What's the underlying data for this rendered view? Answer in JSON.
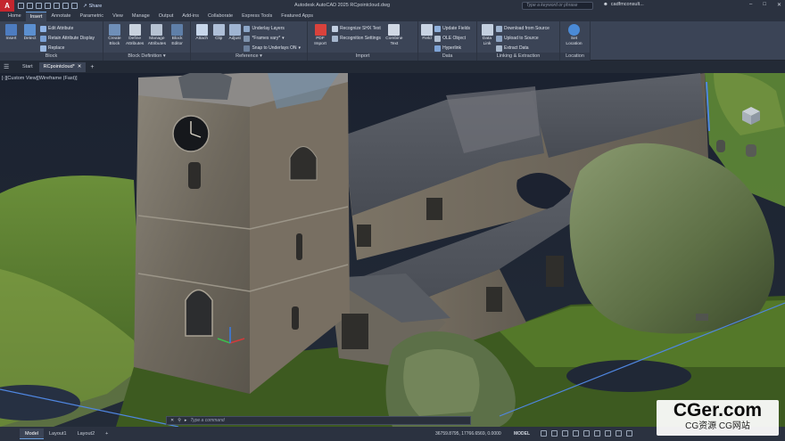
{
  "titlebar": {
    "app_letter": "A",
    "share_label": "Share",
    "title": "Autodesk AutoCAD 2025   RCpointcloud.dwg",
    "search_placeholder": "Type a keyword or phrase",
    "user": "cadfmconsult..."
  },
  "ribbon_tabs": [
    "Home",
    "Insert",
    "Annotate",
    "Parametric",
    "View",
    "Manage",
    "Output",
    "Add-ins",
    "Collaborate",
    "Express Tools",
    "Featured Apps"
  ],
  "active_ribbon_tab": "Insert",
  "panels": {
    "block": {
      "title": "Block",
      "insert": "Insert",
      "detect": "Detect",
      "edit_attribute": "Edit Attribute",
      "retain_attribute_display": "Retain Attribute Display",
      "replace": "Replace"
    },
    "block_definition": {
      "title": "Block Definition",
      "create_block": "Create Block",
      "define_attributes": "Define Attributes",
      "manage_attributes": "Manage Attributes",
      "block_editor": "Block Editor"
    },
    "reference": {
      "title": "Reference",
      "attach": "Attach",
      "clip": "Clip",
      "adjust": "Adjust",
      "underlay_layers": "Underlay Layers",
      "frames_vary": "*Frames vary*",
      "snap_to_underlays": "Snap to Underlays ON"
    },
    "import": {
      "title": "Import",
      "pdf_import": "PDF Import",
      "recognize_shx": "Recognize SHX Text",
      "recognition_settings": "Recognition Settings",
      "combine_text": "Combine Text"
    },
    "data": {
      "title": "Data",
      "field": "Field",
      "update_fields": "Update Fields",
      "ole_object": "OLE Object",
      "hyperlink": "Hyperlink"
    },
    "linking": {
      "title": "Linking & Extraction",
      "data_link": "Data Link",
      "download_from_source": "Download from Source",
      "upload_to_source": "Upload to Source",
      "extract_data": "Extract  Data"
    },
    "location": {
      "title": "Location",
      "set_location": "Set Location"
    }
  },
  "file_tabs": [
    "Start",
    "RCpointcloud*"
  ],
  "viewport": {
    "label": "[-][Custom View][Wireframe (Fast)]",
    "command_placeholder": "Type a command"
  },
  "status": {
    "layout_tabs": [
      "Model",
      "Layout1",
      "Layout2"
    ],
    "coordinates": "36759.8795, 17766.6569, 0.0000",
    "model_indicator": "MODEL"
  },
  "watermark": {
    "main": "CGer.com",
    "sub": "CG资源 CG网站"
  },
  "colors": {
    "accent": "#6aa0e0",
    "ribbon_bg": "#3b4456",
    "titlebar_bg": "#2b3240",
    "app_red": "#c4262e"
  }
}
